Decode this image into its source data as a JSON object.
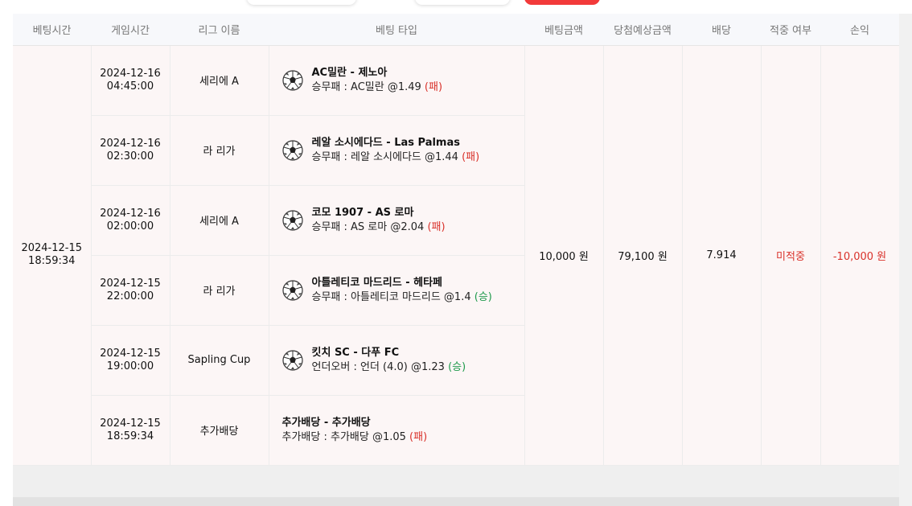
{
  "headers": [
    "베팅시간",
    "게임시간",
    "리그 이름",
    "베팅 타입",
    "베팅금액",
    "당첨예상금액",
    "배당",
    "적중 여부",
    "손익"
  ],
  "bet_time": "2024-12-15\n18:59:34",
  "bet_amount": "10,000 원",
  "expected_payout": "79,100 원",
  "odds": "7.914",
  "status": "미적중",
  "profit": "-10,000 원",
  "colors": {
    "lose": "#d9322b",
    "win": "#1f9a4c",
    "row_bg": "#fcf6f6",
    "header_bg": "#f7f8fb"
  },
  "rows": [
    {
      "game_time": "2024-12-16\n04:45:00",
      "league": "세리에 A",
      "match": "AC밀란 - 제노아",
      "pick": "승무패 : AC밀란 @1.49",
      "result": "(패)",
      "result_type": "lose",
      "icon": "soccer-ball-icon"
    },
    {
      "game_time": "2024-12-16\n02:30:00",
      "league": "라 리가",
      "match": "레알 소시에다드 - Las Palmas",
      "pick": "승무패 : 레알 소시에다드 @1.44",
      "result": "(패)",
      "result_type": "lose",
      "icon": "soccer-ball-icon"
    },
    {
      "game_time": "2024-12-16\n02:00:00",
      "league": "세리에 A",
      "match": "코모 1907 - AS 로마",
      "pick": "승무패 : AS 로마 @2.04",
      "result": "(패)",
      "result_type": "lose",
      "icon": "soccer-ball-icon"
    },
    {
      "game_time": "2024-12-15\n22:00:00",
      "league": "라 리가",
      "match": "아틀레티코 마드리드 - 헤타페",
      "pick": "승무패 : 아틀레티코 마드리드 @1.4",
      "result": "(승)",
      "result_type": "win",
      "icon": "soccer-ball-icon"
    },
    {
      "game_time": "2024-12-15\n19:00:00",
      "league": "Sapling Cup",
      "match": "킷치 SC - 다푸 FC",
      "pick": "언더오버 : 언더 (4.0) @1.23",
      "result": "(승)",
      "result_type": "win",
      "icon": "soccer-ball-icon"
    },
    {
      "game_time": "2024-12-15\n18:59:34",
      "league": "추가배당",
      "match": "추가배당 - 추가배당",
      "pick": "추가배당 : 추가배당 @1.05",
      "result": "(패)",
      "result_type": "lose",
      "icon": ""
    }
  ]
}
